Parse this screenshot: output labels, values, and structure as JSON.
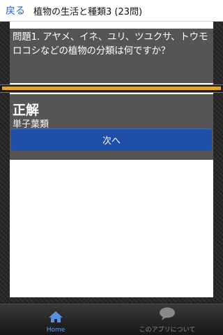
{
  "header": {
    "back_label": "戻る",
    "title": "植物の生活と種類3 (23問)"
  },
  "question": {
    "text": "問題1. アヤメ、イネ、ユリ、ツユクサ、トウモロコシなどの植物の分類は何ですか？"
  },
  "progress": {
    "fraction": 1.0,
    "color": "#e0a52e"
  },
  "answer": {
    "result_label": "正解",
    "answer_text": "単子葉類"
  },
  "next_button": {
    "label": "次へ"
  },
  "bottom_nav": {
    "home_label": "Home",
    "home_icon": "home-icon",
    "about_label": "このアプリについて",
    "about_icon": "speech-bubble-icon"
  }
}
